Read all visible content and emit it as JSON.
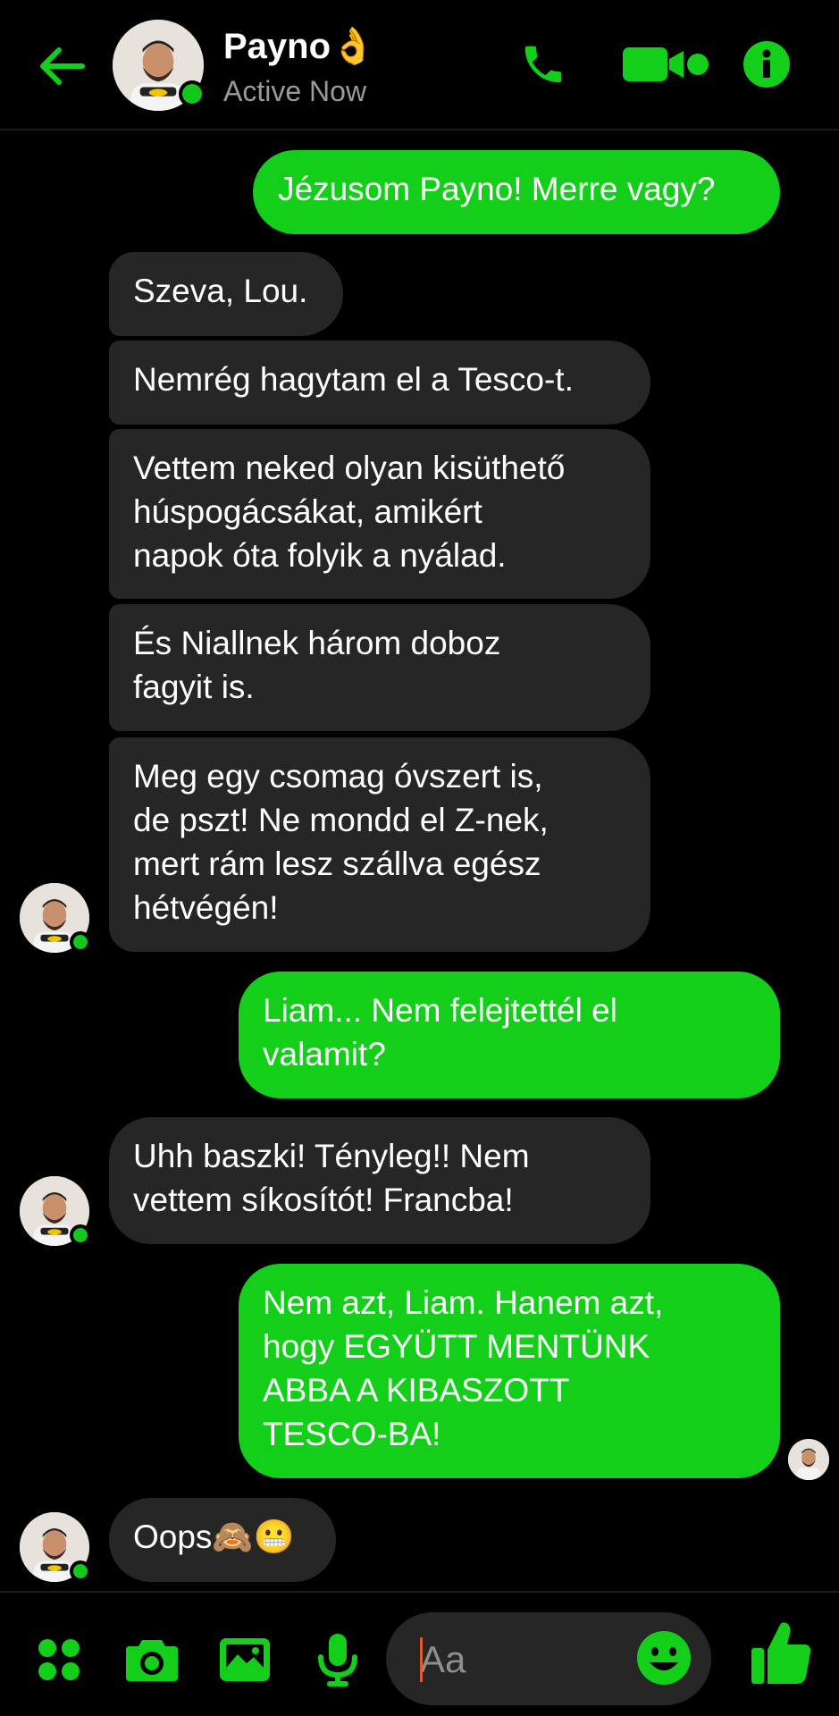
{
  "header": {
    "title": "Payno👌",
    "status": "Active Now"
  },
  "messages": [
    {
      "from": "me",
      "text": "Jézusom Payno! Merre vagy?"
    },
    {
      "from": "them",
      "text": "Szeva, Lou."
    },
    {
      "from": "them",
      "text": "Nemrég hagytam el a Tesco-t."
    },
    {
      "from": "them",
      "text": "Vettem neked olyan kisüthető\nhúspogácsákat, amikért\nnapok óta folyik a nyálad."
    },
    {
      "from": "them",
      "text": "És Niallnek három doboz\nfagyit is."
    },
    {
      "from": "them",
      "text": "Meg egy csomag óvszert is,\nde pszt! Ne mondd el Z-nek,\nmert rám lesz szállva egész\nhétvégén!"
    },
    {
      "from": "me",
      "text": "Liam... Nem felejtettél el\nvalamit?"
    },
    {
      "from": "them",
      "text": "Uhh baszki! Tényleg!! Nem\nvettem síkosítót! Francba!"
    },
    {
      "from": "me",
      "text": "Nem azt, Liam. Hanem azt,\nhogy EGYÜTT MENTÜNK\nABBA A KIBASZOTT\nTESCO-BA!"
    },
    {
      "from": "them",
      "text": "Oops🙈😬"
    }
  ],
  "composer": {
    "placeholder": "Aa"
  },
  "icons": {
    "back": "arrow-left-icon",
    "phone": "phone-icon",
    "video": "video-camera-icon",
    "info": "info-icon",
    "menu": "four-dots-icon",
    "camera": "camera-icon",
    "gallery": "image-icon",
    "mic": "microphone-icon",
    "emoji": "smiley-icon",
    "like": "thumbs-up-icon"
  },
  "colors": {
    "accent": "#13cf1a",
    "background": "#000000",
    "incoming_bubble": "#262626",
    "outgoing_bubble": "#13cf1a"
  }
}
